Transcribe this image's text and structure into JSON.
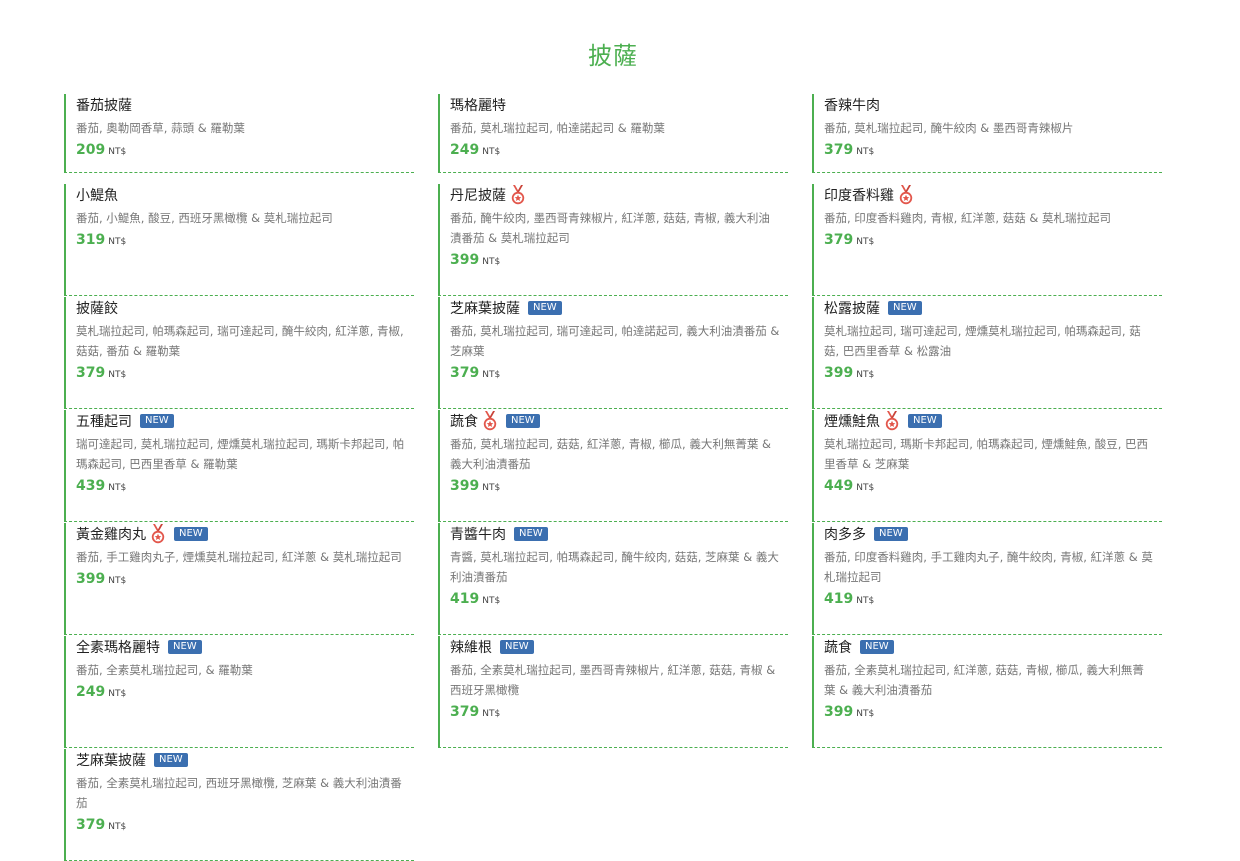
{
  "title": "披薩",
  "price_unit": "NT$",
  "new_label": "NEW",
  "colors": {
    "accent": "#4caf50",
    "badge": "#3b6fb0",
    "medal": "#e2564b"
  },
  "items": [
    {
      "name": "番茄披薩",
      "desc": "番茄, 奧勒岡香草, 蒜頭 & 羅勒葉",
      "price": "209",
      "medal": false,
      "new": false
    },
    {
      "name": "瑪格麗特",
      "desc": "番茄, 莫札瑞拉起司, 帕達諾起司 & 羅勒葉",
      "price": "249",
      "medal": false,
      "new": false
    },
    {
      "name": "香辣牛肉",
      "desc": "番茄, 莫札瑞拉起司, 醃牛絞肉 & 墨西哥青辣椒片",
      "price": "379",
      "medal": false,
      "new": false
    },
    {
      "name": "小鯷魚",
      "desc": "番茄, 小鯷魚, 酸豆, 西班牙黑橄欖 & 莫札瑞拉起司",
      "price": "319",
      "medal": false,
      "new": false
    },
    {
      "name": "丹尼披薩",
      "desc": "番茄, 醃牛絞肉, 墨西哥青辣椒片, 紅洋蔥, 菇菇, 青椒, 義大利油漬番茄 & 莫札瑞拉起司",
      "price": "399",
      "medal": true,
      "new": false
    },
    {
      "name": "印度香料雞",
      "desc": "番茄, 印度香料雞肉, 青椒, 紅洋蔥, 菇菇 & 莫札瑞拉起司",
      "price": "379",
      "medal": true,
      "new": false
    },
    {
      "name": "披薩餃",
      "desc": "莫札瑞拉起司, 帕瑪森起司, 瑞可達起司, 醃牛絞肉, 紅洋蔥, 青椒, 菇菇, 番茄 & 羅勒葉",
      "price": "379",
      "medal": false,
      "new": false
    },
    {
      "name": "芝麻葉披薩",
      "desc": "番茄, 莫札瑞拉起司, 瑞可達起司, 帕達諾起司, 義大利油漬番茄 & 芝麻葉",
      "price": "379",
      "medal": false,
      "new": true
    },
    {
      "name": "松露披薩",
      "desc": "莫札瑞拉起司, 瑞可達起司, 煙燻莫札瑞拉起司, 帕瑪森起司, 菇菇, 巴西里香草 & 松露油",
      "price": "399",
      "medal": false,
      "new": true
    },
    {
      "name": "五種起司",
      "desc": "瑞可達起司, 莫札瑞拉起司, 煙燻莫札瑞拉起司, 瑪斯卡邦起司, 帕瑪森起司, 巴西里香草 & 羅勒葉",
      "price": "439",
      "medal": false,
      "new": true
    },
    {
      "name": "蔬食",
      "desc": "番茄, 莫札瑞拉起司, 菇菇, 紅洋蔥, 青椒, 櫛瓜, 義大利無菁葉 & 義大利油漬番茄",
      "price": "399",
      "medal": true,
      "new": true
    },
    {
      "name": "煙燻鮭魚",
      "desc": "莫札瑞拉起司, 瑪斯卡邦起司, 帕瑪森起司, 煙燻鮭魚, 酸豆, 巴西里香草 & 芝麻葉",
      "price": "449",
      "medal": true,
      "new": true
    },
    {
      "name": "黃金雞肉丸",
      "desc": "番茄, 手工雞肉丸子, 煙燻莫札瑞拉起司, 紅洋蔥 & 莫札瑞拉起司",
      "price": "399",
      "medal": true,
      "new": true
    },
    {
      "name": "青醬牛肉",
      "desc": "青醬, 莫札瑞拉起司, 帕瑪森起司, 醃牛絞肉, 菇菇, 芝麻葉 & 義大利油漬番茄",
      "price": "419",
      "medal": false,
      "new": true
    },
    {
      "name": "肉多多",
      "desc": "番茄, 印度香料雞肉, 手工雞肉丸子, 醃牛絞肉, 青椒, 紅洋蔥 & 莫札瑞拉起司",
      "price": "419",
      "medal": false,
      "new": true
    },
    {
      "name": "全素瑪格麗特",
      "desc": "番茄, 全素莫札瑞拉起司, & 羅勒葉",
      "price": "249",
      "medal": false,
      "new": true
    },
    {
      "name": "辣維根",
      "desc": "番茄, 全素莫札瑞拉起司, 墨西哥青辣椒片, 紅洋蔥, 菇菇, 青椒 & 西班牙黑橄欖",
      "price": "379",
      "medal": false,
      "new": true
    },
    {
      "name": "蔬食",
      "desc": "番茄, 全素莫札瑞拉起司, 紅洋蔥, 菇菇, 青椒, 櫛瓜, 義大利無菁葉 & 義大利油漬番茄",
      "price": "399",
      "medal": false,
      "new": true
    },
    {
      "name": "芝麻葉披薩",
      "desc": "番茄, 全素莫札瑞拉起司, 西班牙黑橄欖, 芝麻葉 & 義大利油漬番茄",
      "price": "379",
      "medal": false,
      "new": true
    }
  ]
}
